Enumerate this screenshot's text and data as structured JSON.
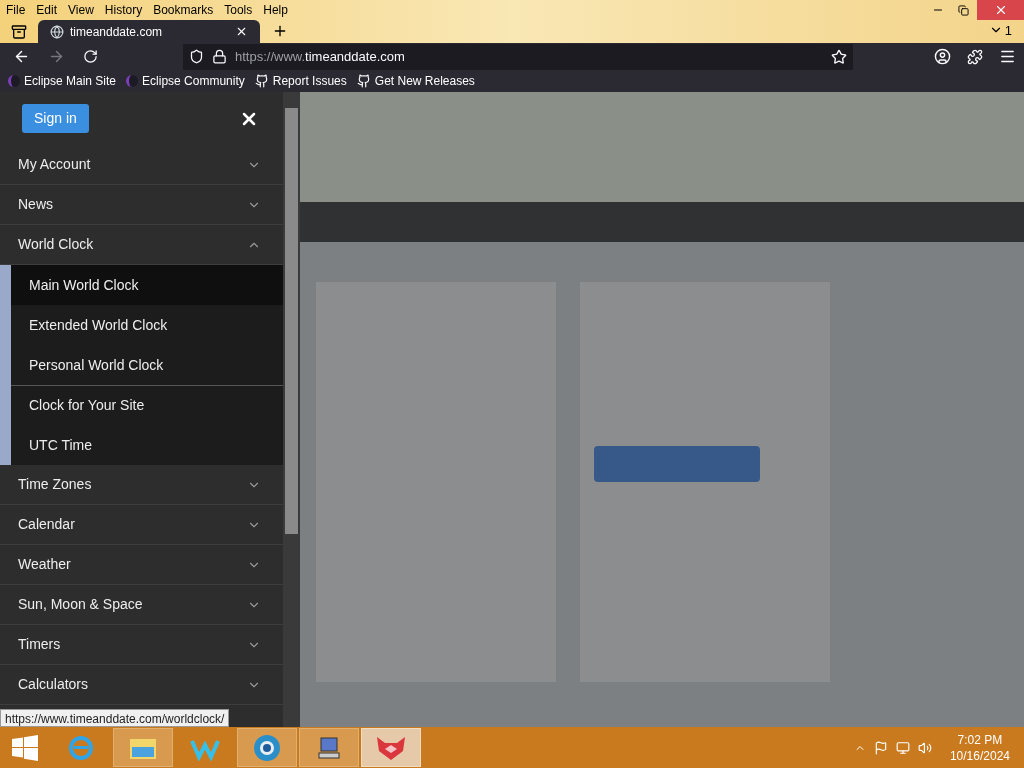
{
  "menu_bar": [
    "File",
    "Edit",
    "View",
    "History",
    "Bookmarks",
    "Tools",
    "Help"
  ],
  "tab_count": "1",
  "tab": {
    "title": "timeanddate.com",
    "selected": true
  },
  "address": {
    "url_prefix": "https://www.",
    "url_domain": "timeanddate.com"
  },
  "bookmarks": [
    {
      "label": "Eclipse Main Site",
      "kind": "eclipse"
    },
    {
      "label": "Eclipse Community",
      "kind": "eclipse"
    },
    {
      "label": "Report Issues",
      "kind": "github"
    },
    {
      "label": "Get New Releases",
      "kind": "github"
    }
  ],
  "sidebar": {
    "sign_in": "Sign in",
    "items": [
      {
        "label": "My Account",
        "expanded": false
      },
      {
        "label": "News",
        "expanded": false
      },
      {
        "label": "World Clock",
        "expanded": true,
        "children": [
          {
            "label": "Main World Clock",
            "selected": true,
            "separated": false
          },
          {
            "label": "Extended World Clock",
            "selected": false,
            "separated": false
          },
          {
            "label": "Personal World Clock",
            "selected": false,
            "separated": false
          },
          {
            "label": "Clock for Your Site",
            "selected": false,
            "separated": true
          },
          {
            "label": "UTC Time",
            "selected": false,
            "separated": false
          }
        ]
      },
      {
        "label": "Time Zones",
        "expanded": false
      },
      {
        "label": "Calendar",
        "expanded": false
      },
      {
        "label": "Weather",
        "expanded": false
      },
      {
        "label": "Sun, Moon & Space",
        "expanded": false
      },
      {
        "label": "Timers",
        "expanded": false
      },
      {
        "label": "Calculators",
        "expanded": false
      }
    ]
  },
  "status_url": "https://www.timeanddate.com/worldclock/",
  "taskbar": {
    "apps": [
      {
        "kind": "ie",
        "selected": false
      },
      {
        "kind": "explorer",
        "selected": true
      },
      {
        "kind": "w",
        "selected": false
      },
      {
        "kind": "globe",
        "selected": true
      },
      {
        "kind": "computer",
        "selected": true
      },
      {
        "kind": "fox",
        "selected": true
      }
    ],
    "time": "7:02 PM",
    "date": "10/16/2024"
  }
}
